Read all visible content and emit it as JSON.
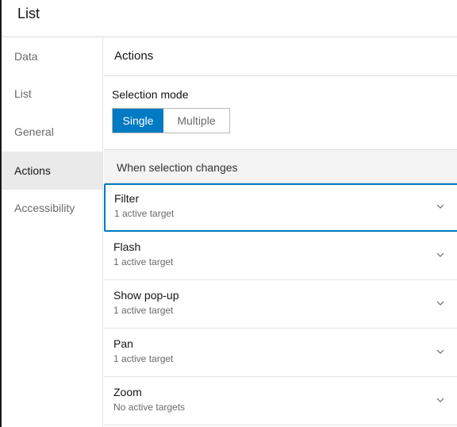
{
  "header": {
    "title": "List"
  },
  "sidebar": {
    "items": [
      {
        "label": "Data"
      },
      {
        "label": "List"
      },
      {
        "label": "General"
      },
      {
        "label": "Actions"
      },
      {
        "label": "Accessibility"
      }
    ],
    "active_index": 3
  },
  "main": {
    "title": "Actions",
    "selection_mode": {
      "label": "Selection mode",
      "options": [
        "Single",
        "Multiple"
      ],
      "selected": "Single"
    },
    "section_title": "When selection changes",
    "actions": [
      {
        "name": "Filter",
        "status": "1 active target",
        "focused": true
      },
      {
        "name": "Flash",
        "status": "1 active target"
      },
      {
        "name": "Show pop-up",
        "status": "1 active target"
      },
      {
        "name": "Pan",
        "status": "1 active target"
      },
      {
        "name": "Zoom",
        "status": "No active targets"
      }
    ]
  },
  "colors": {
    "accent": "#007ac2",
    "active_nav_bg": "#eaeaea"
  },
  "icons": {
    "accordion": "chevron-down-icon"
  }
}
